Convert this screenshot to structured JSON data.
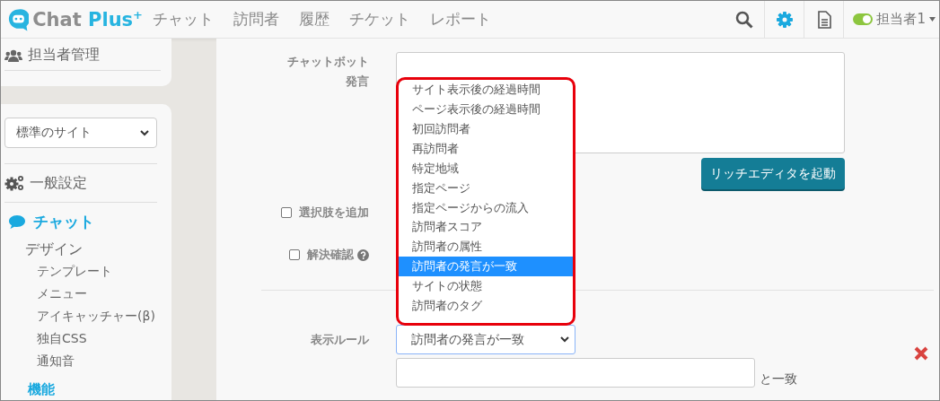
{
  "header": {
    "logo": {
      "part1": "Chat",
      "part2": "Plus",
      "sup": "+"
    },
    "nav": [
      {
        "label": "チャット"
      },
      {
        "label": "訪問者"
      },
      {
        "label": "履歴"
      },
      {
        "label": "チケット"
      },
      {
        "label": "レポート"
      }
    ],
    "tools": [
      {
        "kind": "search",
        "selected": false
      },
      {
        "kind": "settings",
        "selected": true
      },
      {
        "kind": "document",
        "selected": false
      }
    ],
    "user": {
      "online": true,
      "name": "担当者1"
    }
  },
  "sidebar": {
    "staff_item": "担当者管理",
    "site_select": "標準のサイト",
    "general_item": "一般設定",
    "chat": {
      "label": "チャット",
      "children": [
        {
          "label": "デザイン",
          "children": [
            {
              "label": "テンプレート"
            },
            {
              "label": "メニュー"
            },
            {
              "label": "アイキャッチャー(β)"
            },
            {
              "label": "独自CSS"
            },
            {
              "label": "通知音"
            }
          ]
        }
      ]
    },
    "next_heading": "機能"
  },
  "form": {
    "message_label_lines": [
      "チャットボット",
      "発言"
    ],
    "rich_editor_button": "リッチエディタを起動",
    "checkboxes": [
      {
        "label": "選択肢を追加",
        "checked": false,
        "help": false
      },
      {
        "label": "解決確認",
        "checked": false,
        "help": true
      }
    ],
    "display_rule": {
      "label": "表示ルール",
      "value": "訪問者の発言が一致",
      "open": true,
      "match_suffix": "と一致",
      "options": [
        {
          "label": "サイト表示後の経過時間",
          "selected": false
        },
        {
          "label": "ページ表示後の経過時間",
          "selected": false
        },
        {
          "label": "初回訪問者",
          "selected": false
        },
        {
          "label": "再訪問者",
          "selected": false
        },
        {
          "label": "特定地域",
          "selected": false
        },
        {
          "label": "指定ページ",
          "selected": false
        },
        {
          "label": "指定ページからの流入",
          "selected": false
        },
        {
          "label": "訪問者スコア",
          "selected": false
        },
        {
          "label": "訪問者の属性",
          "selected": false
        },
        {
          "label": "訪問者の発言が一致",
          "selected": true
        },
        {
          "label": "サイトの状態",
          "selected": false
        },
        {
          "label": "訪問者のタグ",
          "selected": false
        }
      ]
    }
  }
}
